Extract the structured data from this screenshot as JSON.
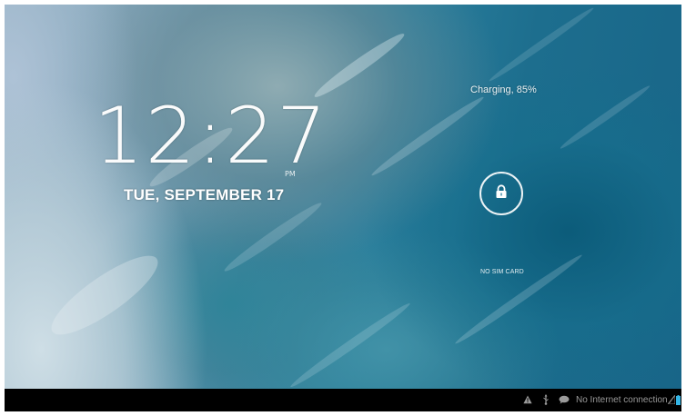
{
  "lockscreen": {
    "clock": "12:27",
    "ampm": "PM",
    "date": "TUE, SEPTEMBER 17",
    "charging": "Charging, 85%",
    "sim_status": "NO SIM CARD",
    "lock_icon": "padlock-icon"
  },
  "statusbar": {
    "icons": [
      "warning-icon",
      "usb-icon",
      "chat-bubble-icon",
      "signal-icon",
      "battery-icon"
    ],
    "network_text": "No Internet connection",
    "background": "#000000"
  },
  "colors": {
    "text": "#ffffff",
    "statusbar_text": "#9a9a9a"
  }
}
